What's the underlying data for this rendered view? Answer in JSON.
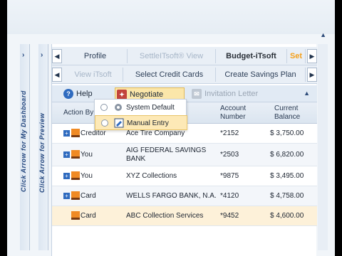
{
  "sidebar_left": {
    "text": "Click Arrow for My Dashboard",
    "arrow": "›"
  },
  "sidebar_preview": {
    "text": "Click Arrow for Preview",
    "arrow": "›"
  },
  "tabs_row1": {
    "prev": "◀",
    "next": "▶",
    "items": [
      {
        "label": "Profile",
        "style": "normal"
      },
      {
        "label": "SettleITsoft® View",
        "style": "dim"
      },
      {
        "label": "Budget-iTsoft",
        "style": "bold"
      },
      {
        "label": "Set",
        "style": "orange"
      }
    ]
  },
  "tabs_row2": {
    "prev": "◀",
    "next": "▶",
    "items": [
      {
        "label": "View iTsoft",
        "style": "dim"
      },
      {
        "label": "Select Credit Cards",
        "style": "normal"
      },
      {
        "label": "Create Savings Plan",
        "style": "normal"
      }
    ]
  },
  "toolbar": {
    "help": "Help",
    "negotiate": "Negotiate Mode",
    "invitation": "Invitation Letter",
    "collapse": "▲"
  },
  "table": {
    "headers": {
      "action_by": "Action By",
      "account_number": "Account Number",
      "current_balance": "Current Balance"
    },
    "rows": [
      {
        "action_by": "Creditor",
        "creditor": "Ace Tire Company",
        "account": "*2152",
        "balance": "$ 3,750.00"
      },
      {
        "action_by": "You",
        "creditor": "AIG FEDERAL SAVINGS BANK",
        "account": "*2503",
        "balance": "$ 6,820.00"
      },
      {
        "action_by": "You",
        "creditor": "XYZ Collections",
        "account": "*9875",
        "balance": "$ 3,495.00"
      },
      {
        "action_by": "Card",
        "creditor": "WELLS FARGO BANK, N.A.",
        "account": "*4120",
        "balance": "$ 4,758.00"
      },
      {
        "action_by": "Card",
        "creditor": "ABC Collection Services",
        "account": "*9452",
        "balance": "$ 4,600.00"
      }
    ]
  },
  "popup": {
    "items": [
      {
        "label": "System Default",
        "icon": "gear-icon"
      },
      {
        "label": "Manual Entry",
        "icon": "edit-icon"
      }
    ]
  },
  "colors": {
    "accent": "#f4a01c",
    "header_blue": "#23467e",
    "highlight": "#fde9b6"
  }
}
